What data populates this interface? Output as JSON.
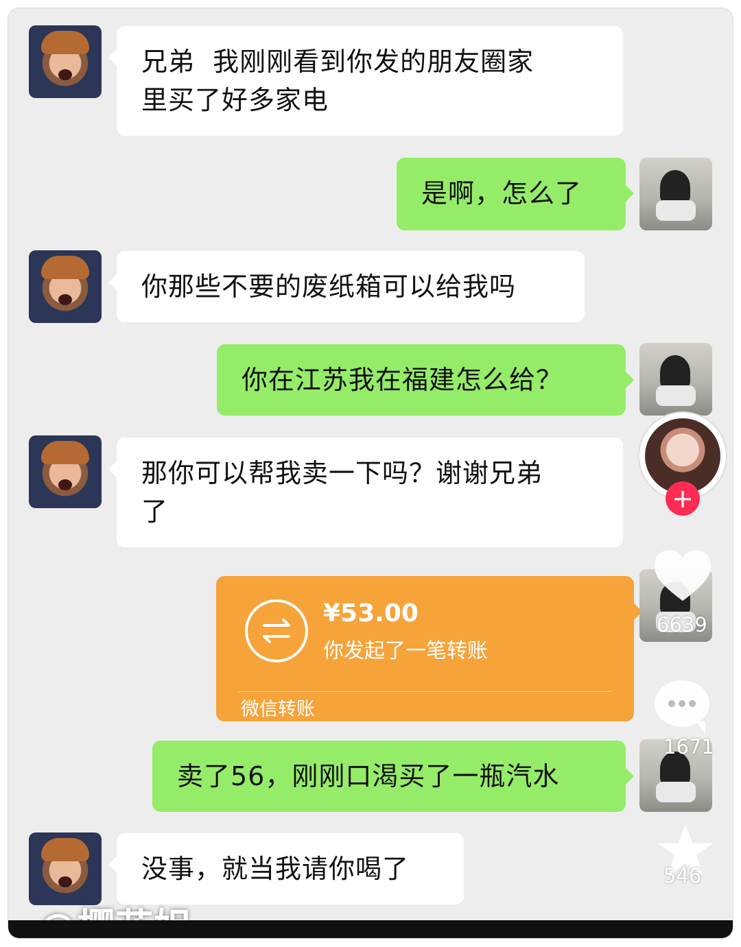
{
  "messages": [
    {
      "text": "兄弟  我刚刚看到你发的朋友圈家\n里买了好多家电"
    },
    {
      "text": "是啊，怎么了"
    },
    {
      "text": "你那些不要的废纸箱可以给我吗"
    },
    {
      "text": "你在江苏我在福建怎么给？"
    },
    {
      "text": "那你可以帮我卖一下吗？谢谢兄弟\n了"
    },
    {
      "text": "卖了56，刚刚口渴买了一瓶汽水"
    },
    {
      "text": "没事，就当我请你喝了"
    }
  ],
  "transfer": {
    "amount": "¥53.00",
    "description": "你发起了一笔转账",
    "footer": "微信转账"
  },
  "side_actions": {
    "like_count": "6639",
    "comment_count": "1671",
    "favorite_count": "546"
  },
  "watermark": "@樱花姐",
  "colors": {
    "background": "#ededed",
    "white_bubble": "#ffffff",
    "green_bubble": "#95ec69",
    "transfer_orange": "#f6a33a",
    "follow_plus": "#fe2c55"
  },
  "icons": {
    "transfer": "exchange-arrows-icon",
    "follow": "plus-icon",
    "like": "heart-icon",
    "comment": "comment-bubble-icon",
    "favorite": "star-icon"
  }
}
